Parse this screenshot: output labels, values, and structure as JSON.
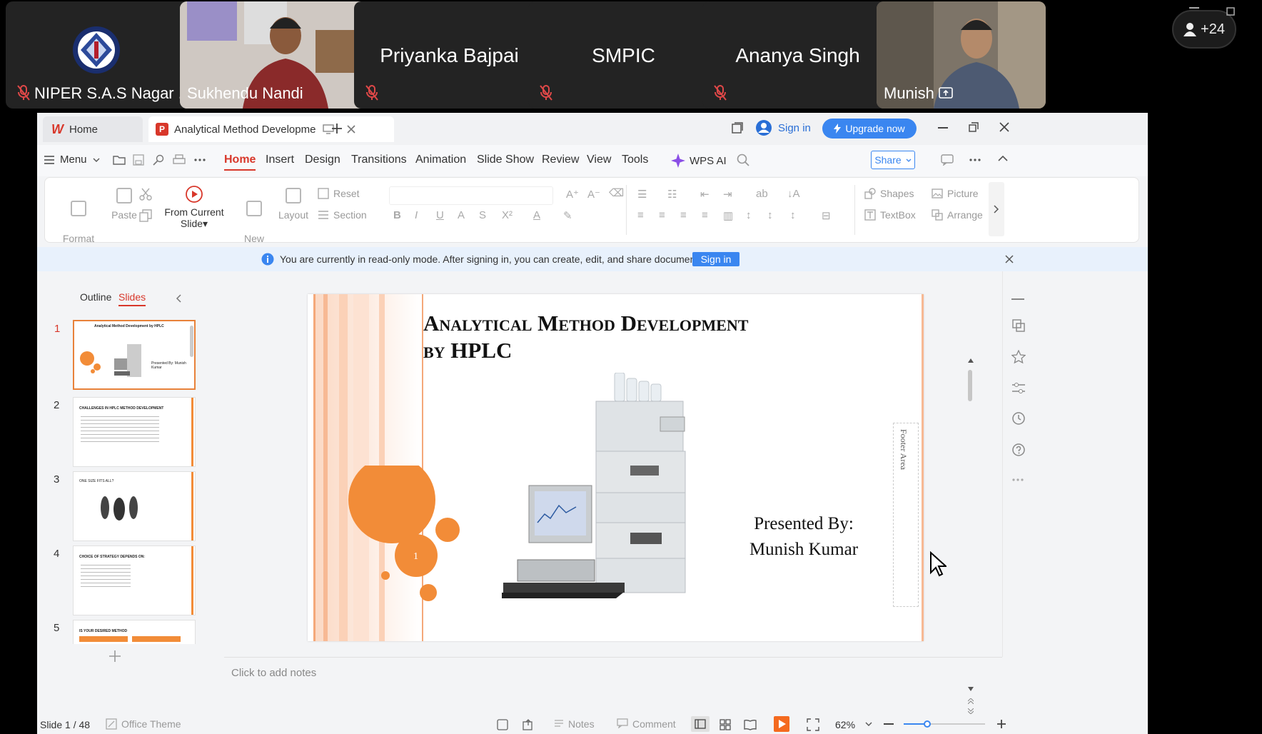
{
  "meeting": {
    "participants": [
      {
        "name": "NIPER S.A.S Nagar ...",
        "muted": true,
        "video": false,
        "logo": true
      },
      {
        "name": "Sukhendu Nandi",
        "muted": false,
        "video": true
      },
      {
        "name": "Priyanka Bajpai",
        "muted": true,
        "video": false
      },
      {
        "name": "SMPIC",
        "muted": true,
        "video": false
      },
      {
        "name": "Ananya Singh",
        "muted": true,
        "video": false
      },
      {
        "name": "Munish",
        "muted": false,
        "video": true,
        "sharing": true
      }
    ],
    "more_count": "+24"
  },
  "app": {
    "tabs": {
      "home": "Home",
      "doc": "Analytical Method Developme"
    },
    "sign_in": "Sign in",
    "upgrade": "Upgrade now",
    "share": "Share",
    "menu_label": "Menu",
    "menus": [
      "Home",
      "Insert",
      "Design",
      "Transitions",
      "Animation",
      "Slide Show",
      "Review",
      "View",
      "Tools"
    ],
    "wps_ai": "WPS AI",
    "ribbon": {
      "format_painter": "Format\nPainter",
      "paste": "Paste",
      "from_current": "From Current",
      "slide": "Slide",
      "new_slide": "New\nSlide",
      "layout": "Layout",
      "reset": "Reset",
      "section": "Section",
      "shapes": "Shapes",
      "picture": "Picture",
      "textbox": "TextBox",
      "arrange": "Arrange"
    },
    "notice": {
      "text": "You are currently in read-only mode. After signing in, you can create, edit, and share documents.",
      "button": "Sign in"
    },
    "panel": {
      "outline": "Outline",
      "slides": "Slides"
    },
    "thumbs": [
      {
        "n": "1",
        "title": "Analytical Method Development by HPLC",
        "sub": "Presented By: Munish Kumar"
      },
      {
        "n": "2",
        "title": "CHALLENGES IN HPLC METHOD DEVELOPMENT",
        "sub": ""
      },
      {
        "n": "3",
        "title": "ONE SIZE FITS ALL?",
        "sub": ""
      },
      {
        "n": "4",
        "title": "CHOICE OF STRATEGY DEPENDS ON:",
        "sub": ""
      },
      {
        "n": "5",
        "title": "IS YOUR DESIRED METHOD",
        "sub": ""
      }
    ],
    "slide": {
      "title_line1": "Analytical Method Development",
      "title_line2": "by HPLC",
      "presented_by": "Presented By:",
      "presenter": "Munish Kumar",
      "footer_area": "Footer Area",
      "page_number": "1"
    },
    "notes_placeholder": "Click to add notes",
    "status": {
      "slide_count": "Slide 1 / 48",
      "theme": "Office Theme",
      "notes": "Notes",
      "comment": "Comment",
      "zoom": "62%",
      "zoom_level": 0.3
    }
  }
}
